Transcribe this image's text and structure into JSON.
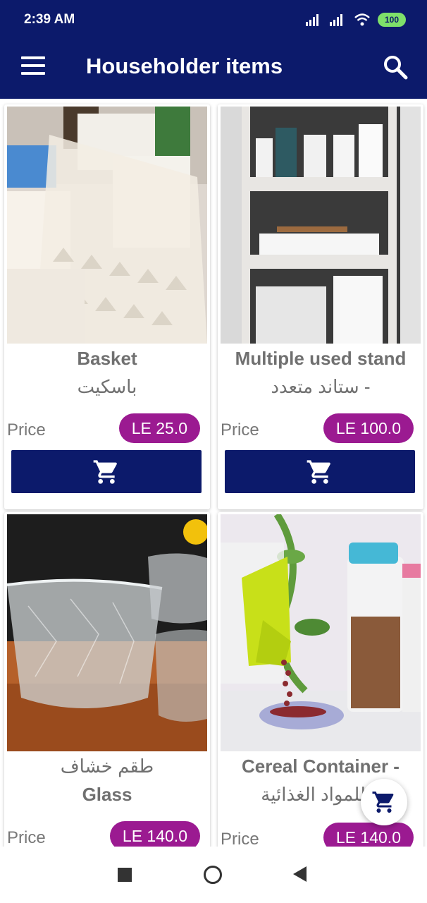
{
  "status_bar": {
    "time": "2:39 AM",
    "battery": "100"
  },
  "app_bar": {
    "title": "Householder items"
  },
  "products": [
    {
      "name_en": "Basket",
      "name_ar": "باسكيت",
      "price_label": "Price",
      "price": "LE 25.0"
    },
    {
      "name_en": "Multiple used stand",
      "name_ar": "ستاند متعدد -",
      "price_label": "Price",
      "price": "LE 100.0"
    },
    {
      "name_en": "Glass",
      "name_ar": "طقم خشاف",
      "price_label": "Price",
      "price": "LE 140.0"
    },
    {
      "name_en": "Cereal Container -",
      "name_ar": "ة للمواد الغذائية",
      "price_label": "Price",
      "price": "LE 140.0"
    }
  ],
  "colors": {
    "primary": "#0c1a6b",
    "price_badge": "#9b1a91",
    "text_gray": "#707070"
  },
  "icons": [
    "menu-icon",
    "search-icon",
    "cart-icon",
    "signal-icon",
    "wifi-icon",
    "battery-icon"
  ]
}
